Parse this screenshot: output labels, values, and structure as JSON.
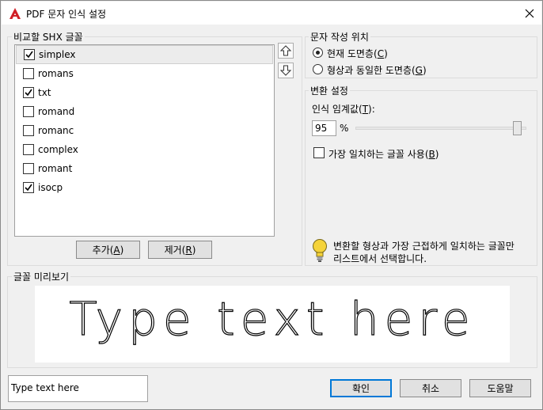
{
  "window": {
    "title": "PDF 문자 인식 설정",
    "close_glyph": "✕"
  },
  "shx_group": {
    "label": "비교할 SHX 글꼴",
    "items": [
      {
        "label": "simplex",
        "checked": true,
        "selected": true
      },
      {
        "label": "romans",
        "checked": false
      },
      {
        "label": "txt",
        "checked": true
      },
      {
        "label": "romand",
        "checked": false
      },
      {
        "label": "romanc",
        "checked": false
      },
      {
        "label": "complex",
        "checked": false
      },
      {
        "label": "romant",
        "checked": false
      },
      {
        "label": "isocp",
        "checked": true
      }
    ],
    "add_button": "추가(",
    "add_key": "A",
    "remove_button": "제거(",
    "remove_key": "R",
    "paren_close": ")"
  },
  "position_group": {
    "label": "문자 작성 위치",
    "option1": "현재 도면층(",
    "option1_key": "C",
    "option2": "형상과 동일한 도면층(",
    "option2_key": "G",
    "selected": "option1"
  },
  "conversion_group": {
    "label": "변환 설정",
    "threshold_label": "인식 임계값(",
    "threshold_key": "T",
    "threshold_suffix": "):",
    "threshold_value": "95",
    "percent": "%",
    "best_match_label": "가장 일치하는 글꼴 사용(",
    "best_match_key": "B",
    "best_match_checked": false,
    "hint_line1": "변환할 형상과 가장 근접하게 일치하는 글꼴만",
    "hint_line2": "리스트에서 선택합니다."
  },
  "preview_group": {
    "label": "글꼴 미리보기",
    "preview_text": "Type text here"
  },
  "footer": {
    "input_value": "Type text here",
    "ok": "확인",
    "cancel": "취소",
    "help": "도움말"
  },
  "colors": {
    "accent": "#0078d7",
    "app_icon_red": "#d01f26",
    "hint_yellow": "#f5d33a"
  }
}
